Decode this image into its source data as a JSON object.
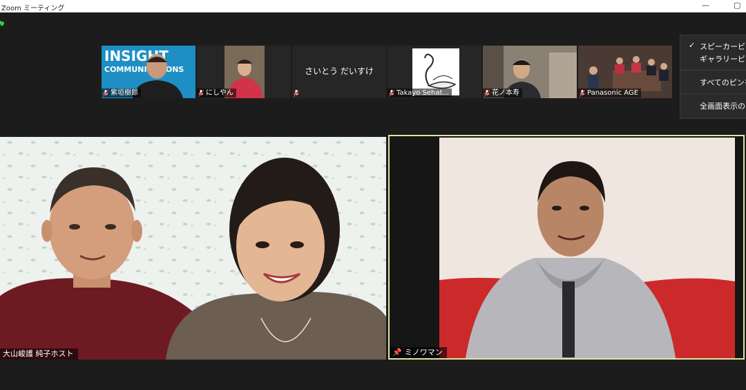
{
  "window": {
    "title": "Zoom ミーティング"
  },
  "thumbnails": [
    {
      "name": "紫垣樹郎",
      "bg_text": [
        "INSIGHT",
        "COMMUNICATIONS"
      ]
    },
    {
      "name": "にしやん"
    },
    {
      "name": "",
      "display_text": "さいとう だいすけ"
    },
    {
      "name": "Takayo Sehat..."
    },
    {
      "name": "花ノ本寿"
    },
    {
      "name": "Panasonic AGE"
    }
  ],
  "view_menu": {
    "items": [
      "スピーカービュー",
      "ギャラリービュー",
      "すべてのピンを",
      "全画面表示の"
    ],
    "checked_index": 0
  },
  "videos": {
    "left": {
      "name": "大山峻護 純子ホスト"
    },
    "right": {
      "name": "ミノワマン",
      "pinned": true,
      "active_speaker_border": "#e3e3a0"
    }
  },
  "colors": {
    "background": "#1c1c1c",
    "mute_red": "#e02828",
    "accent_green": "#2ecc40"
  }
}
